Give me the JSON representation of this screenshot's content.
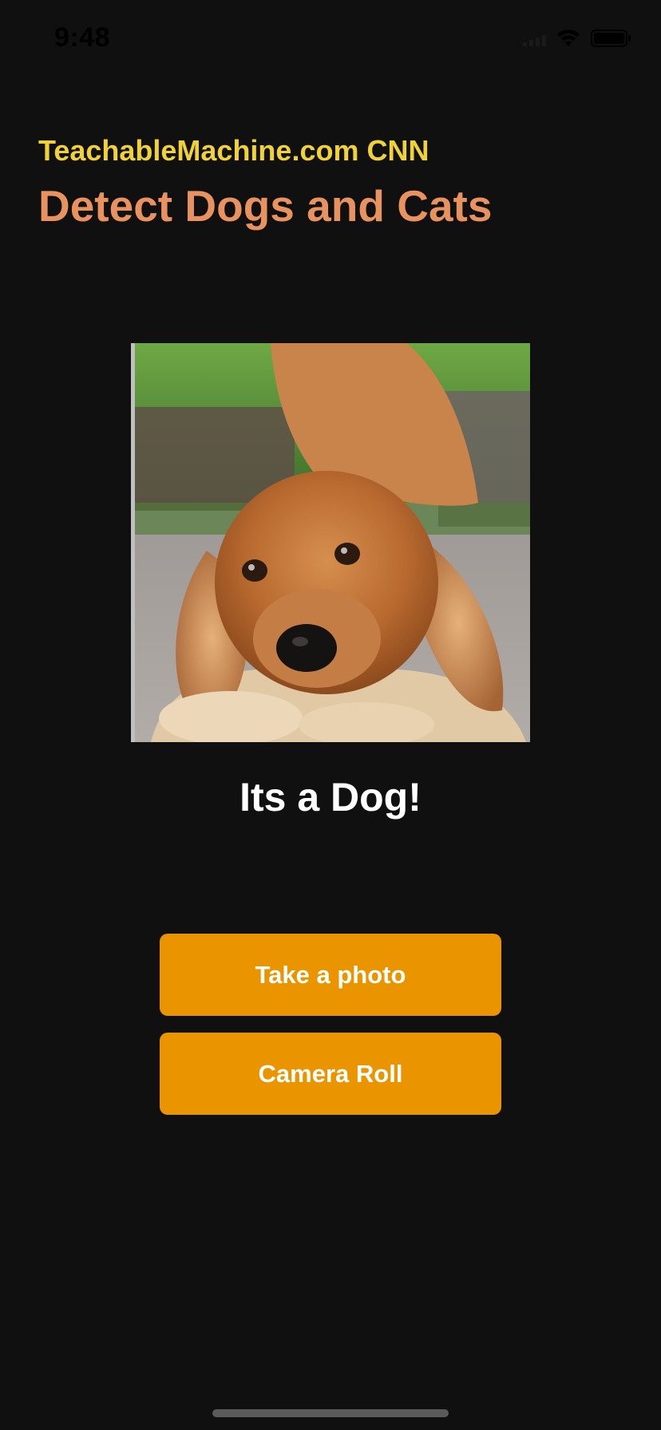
{
  "status_bar": {
    "time": "9:48",
    "icons": [
      "signal-icon",
      "wifi-icon",
      "battery-icon"
    ]
  },
  "header": {
    "subtitle": "TeachableMachine.com CNN",
    "title": "Detect Dogs and Cats"
  },
  "photo": {
    "subject": "dog-photo"
  },
  "result": {
    "text": "Its a Dog!"
  },
  "buttons": {
    "take_photo": "Take a photo",
    "camera_roll": "Camera Roll"
  },
  "colors": {
    "background": "#101010",
    "subtitle": "#F0D236",
    "title": "#E8925F",
    "button": "#EA9400",
    "result_text": "#FFFFFF"
  }
}
